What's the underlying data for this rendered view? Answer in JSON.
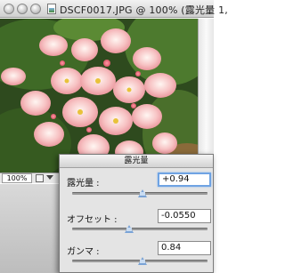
{
  "document": {
    "title": "DSCF0017.JPG @ 100% (露光量 1, ",
    "zoom": "100%"
  },
  "dialog": {
    "title": "露光量",
    "rows": [
      {
        "label": "露光量 :",
        "value": "+0.94",
        "slider_fraction": 0.52
      },
      {
        "label": "オフセット :",
        "value": "-0.0550",
        "slider_fraction": 0.42
      },
      {
        "label": "ガンマ :",
        "value": "0.84",
        "slider_fraction": 0.52
      }
    ]
  },
  "colors": {
    "focus_ring": "#6fa3e3",
    "slider_thumb": "#7aa3d6"
  }
}
